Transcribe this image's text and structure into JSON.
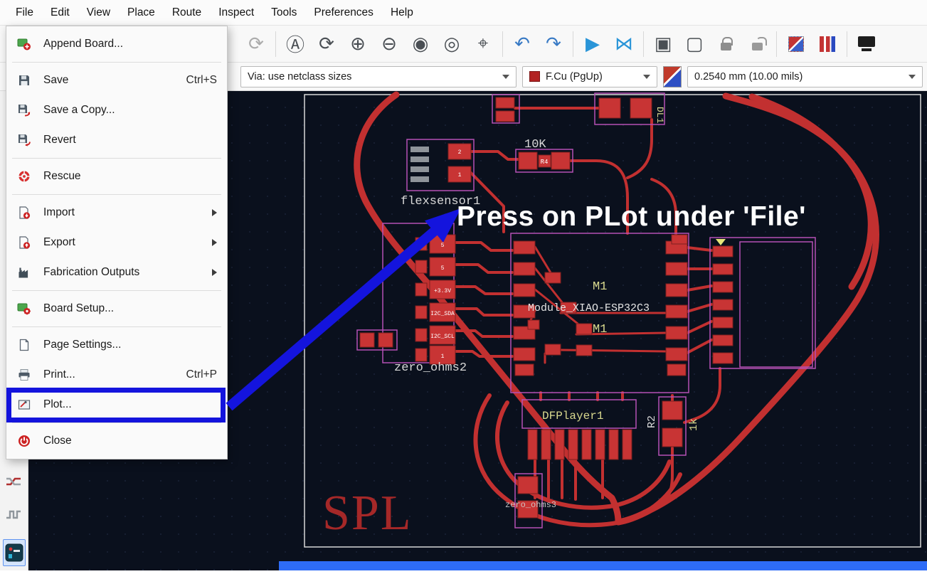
{
  "menubar": {
    "items": [
      "File",
      "Edit",
      "View",
      "Place",
      "Route",
      "Inspect",
      "Tools",
      "Preferences",
      "Help"
    ]
  },
  "file_menu": {
    "items": [
      {
        "label": "Append Board...",
        "shortcut": "",
        "icon": "append-board-icon"
      },
      {
        "label": "Save",
        "shortcut": "Ctrl+S",
        "icon": "save-icon"
      },
      {
        "label": "Save a Copy...",
        "shortcut": "",
        "icon": "save-copy-icon"
      },
      {
        "label": "Revert",
        "shortcut": "",
        "icon": "revert-icon"
      },
      {
        "label": "Rescue",
        "shortcut": "",
        "icon": "rescue-icon"
      },
      {
        "label": "Import",
        "shortcut": "",
        "icon": "import-icon",
        "submenu": true
      },
      {
        "label": "Export",
        "shortcut": "",
        "icon": "export-icon",
        "submenu": true
      },
      {
        "label": "Fabrication Outputs",
        "shortcut": "",
        "icon": "fabrication-outputs-icon",
        "submenu": true
      },
      {
        "label": "Board Setup...",
        "shortcut": "",
        "icon": "board-setup-icon"
      },
      {
        "label": "Page Settings...",
        "shortcut": "",
        "icon": "page-settings-icon"
      },
      {
        "label": "Print...",
        "shortcut": "Ctrl+P",
        "icon": "print-icon"
      },
      {
        "label": "Plot...",
        "shortcut": "",
        "icon": "plot-icon",
        "highlighted": true
      },
      {
        "label": "Close",
        "shortcut": "",
        "icon": "close-icon"
      }
    ]
  },
  "toolbar": {
    "buttons": [
      {
        "name": "refresh-disabled-icon",
        "glyph": "⟳"
      },
      {
        "name": "zoom-to-objects-icon",
        "glyph": "Ⓐ"
      },
      {
        "name": "refresh-view-icon",
        "glyph": "⟳"
      },
      {
        "name": "zoom-in-icon",
        "glyph": "⊕"
      },
      {
        "name": "zoom-out-icon",
        "glyph": "⊖"
      },
      {
        "name": "zoom-fit-icon",
        "glyph": "◉"
      },
      {
        "name": "zoom-fit-objects-icon",
        "glyph": "◎"
      },
      {
        "name": "zoom-to-selection-icon",
        "glyph": "⌖"
      },
      {
        "name": "undo-icon",
        "glyph": "↶"
      },
      {
        "name": "redo-icon",
        "glyph": "↷"
      },
      {
        "name": "find-next-icon",
        "glyph": "▶"
      },
      {
        "name": "flip-board-icon",
        "glyph": "⋈"
      },
      {
        "name": "group-icon",
        "glyph": "▣"
      },
      {
        "name": "ungroup-icon",
        "glyph": "▢"
      }
    ]
  },
  "toolbar2": {
    "via": "Via: use netclass sizes",
    "layer": "F.Cu (PgUp)",
    "layer_color": "#b22222",
    "track_width": "0.2540 mm (10.00 mils)"
  },
  "annotation": {
    "text": "Press on PLot under 'File'",
    "arrow_color": "#1414dd",
    "box_color": "#1414dd"
  },
  "pcb": {
    "labels": {
      "flexsensor1": "flexsensor1",
      "r4_value": "10K",
      "r4_ref": "R4",
      "dl1": "DL1",
      "m1_top": "M1",
      "module": "Module_XIAO-ESP32C3",
      "m1_bottom": "M1",
      "zero_ohms2": "zero_ohms2",
      "dfplayer1": "DFPlayer1",
      "r2": "R2",
      "onek": "1k",
      "zero_ohms3": "zero_ohms3",
      "spl": "SPL"
    },
    "pad_texts": {
      "flex_pads": [
        "2",
        "1"
      ],
      "zero_ohms2_pads": [
        "5",
        "5",
        "+3.3V",
        "I2C_SDA",
        "I2C_SCL",
        "1"
      ]
    },
    "colors": {
      "trace": "#c23030",
      "pad": "#c83434",
      "outline": "#b551b5",
      "background": "#0a101d",
      "silk_text": "#d8d8d8",
      "value_text": "#d9d98f",
      "sheet_border": "#d8d8d8",
      "spl_text": "#a52828"
    }
  }
}
